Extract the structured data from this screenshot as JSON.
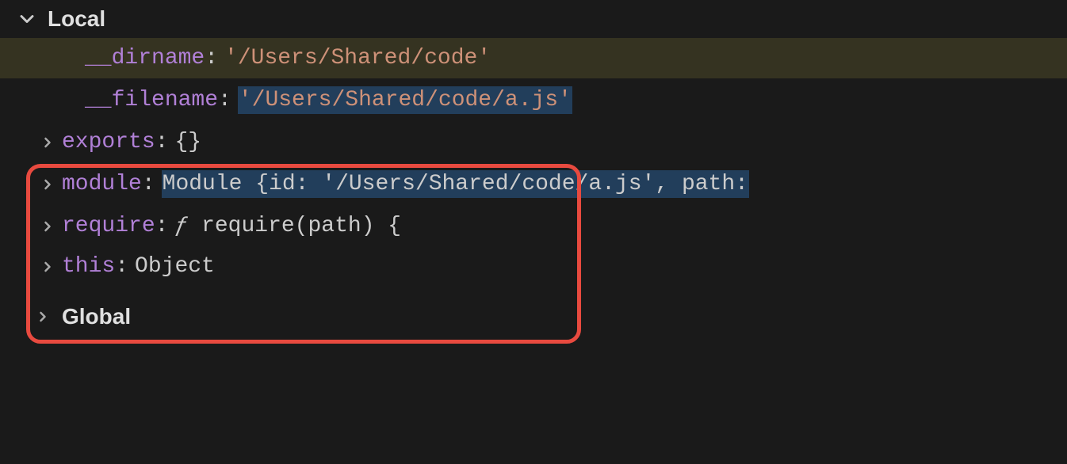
{
  "scopes": {
    "local": {
      "label": "Local",
      "vars": {
        "dirname": {
          "name": "__dirname",
          "value": "'/Users/Shared/code'"
        },
        "filename": {
          "name": "__filename",
          "value": "'/Users/Shared/code/a.js'"
        },
        "exports": {
          "name": "exports",
          "value": "{}"
        },
        "module": {
          "name": "module",
          "value": "Module {id: '/Users/Shared/code/a.js', path:"
        },
        "require": {
          "name": "require",
          "fn_symbol": "ƒ",
          "value": "require(path) {"
        },
        "this": {
          "name": "this",
          "value": "Object"
        }
      }
    },
    "global": {
      "label": "Global"
    }
  }
}
